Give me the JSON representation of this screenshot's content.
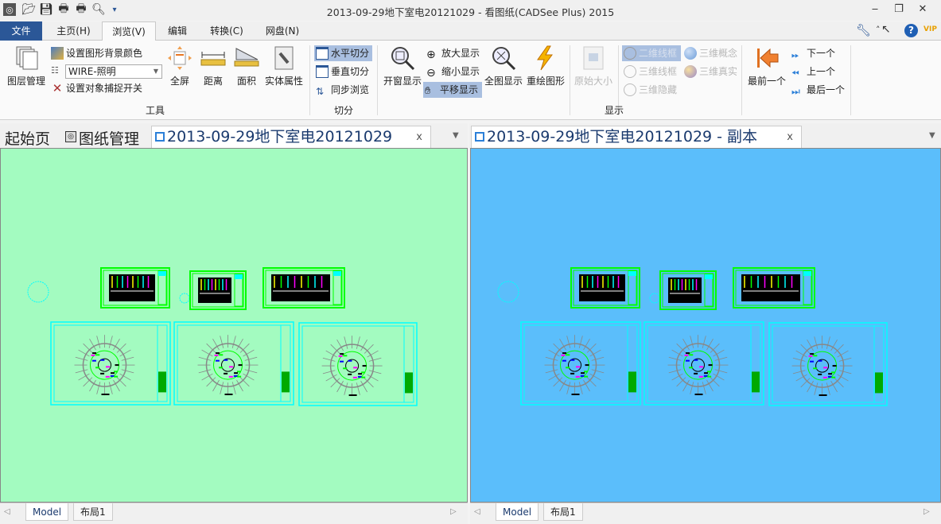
{
  "window": {
    "title": "2013-09-29地下室电20121029 - 看图纸(CADSee Plus) 2015",
    "minimize": "‒",
    "restore": "❐",
    "close": "✕"
  },
  "quick_access": {
    "more": "▾"
  },
  "menu": {
    "tabs": [
      "文件",
      "主页(H)",
      "浏览(V)",
      "编辑",
      "转换(C)",
      "网盘(N)"
    ],
    "active": "浏览(V)"
  },
  "help_icons": {
    "collapse": "˄",
    "vip": "VIP",
    "help": "?"
  },
  "ribbon": {
    "tools": {
      "label": "工具",
      "layer_mgmt": "图层管理",
      "set_bg": "设置图形背景颜色",
      "render_mode": "WIRE-照明",
      "snap": "设置对象捕捉开关",
      "fullscreen": "全屏",
      "distance": "距离",
      "area": "面积",
      "props": "实体属性"
    },
    "split": {
      "label": "切分",
      "horizontal": "水平切分",
      "vertical": "垂直切分",
      "sync": "同步浏览"
    },
    "display": {
      "label": "显示",
      "window": "开窗显示",
      "zoom_in": "放大显示",
      "zoom_out": "缩小显示",
      "pan": "平移显示",
      "extents": "全图显示",
      "regen": "重绘图形",
      "original": "原始大小",
      "wire2d": "二维线框",
      "concept3d": "三维概念",
      "wire3d": "三维线框",
      "real3d": "三维真实",
      "hidden3d": "三维隐藏",
      "first": "最前一个",
      "next": "下一个",
      "prev": "上一个",
      "last": "最后一个"
    }
  },
  "doc_tabs": {
    "start": "起始页",
    "drawing_mgmt": "图纸管理",
    "left_tab": "2013-09-29地下室电20121029",
    "right_tab": "2013-09-29地下室电20121029 - 副本",
    "close": "x",
    "dropdown": "▼"
  },
  "panes": {
    "left_bg": "#a3fbc0",
    "right_bg": "#5bbefb"
  },
  "layout_tabs": {
    "model": "Model",
    "layout1": "布局1",
    "scroll_left": "◁",
    "scroll_right": "▷"
  }
}
